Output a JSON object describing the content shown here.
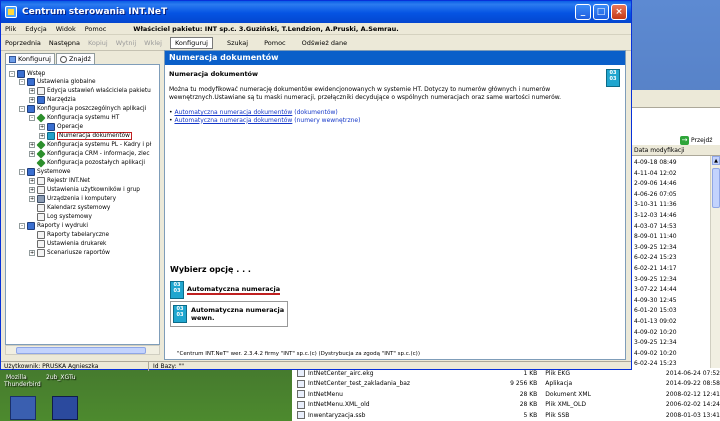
{
  "window": {
    "title": "Centrum sterowania INT.NeT",
    "buttons": {
      "minimize": "_",
      "maximize": "□",
      "close": "×"
    }
  },
  "menubar": {
    "items": [
      "Plik",
      "Edycja",
      "Widok",
      "Pomoc"
    ],
    "owner": "Właściciel pakietu: INT sp.c. 3.Guziński, T.Lendzion, A.Pruski, A.Semrau."
  },
  "toolbar": {
    "prev": "Poprzednia",
    "next": "Następna",
    "copy": "Kopiuj",
    "cut": "Wytnij",
    "paste": "Wklej",
    "config": "Konfiguruj",
    "search": "Szukaj",
    "help": "Pomoc",
    "refresh": "Odśwież dane"
  },
  "left_tabs": {
    "config": "Konfiguruj",
    "find": "Znajdź"
  },
  "tree": [
    {
      "label": "Wstęp",
      "pm": "-"
    },
    {
      "label": "Ustawienia globalne",
      "pm": "-"
    },
    {
      "label": "Edycja ustawień właściciela pakietu",
      "pm": "+"
    },
    {
      "label": "Narzędzia",
      "pm": "+"
    },
    {
      "label": "Konfiguracja poszczególnych aplikacji",
      "pm": "-"
    },
    {
      "label": "Konfiguracja systemu HT",
      "pm": "-"
    },
    {
      "label": "Operacje",
      "pm": "+"
    },
    {
      "label": "Numeracja dokumentów",
      "pm": "+"
    },
    {
      "label": "Konfiguracja systemu PL - Kadry i pł",
      "pm": "+"
    },
    {
      "label": "Konfiguracja CRM - informacje, zlec",
      "pm": "+"
    },
    {
      "label": "Konfiguracja pozostałych aplikacji",
      "pm": ""
    },
    {
      "label": "Systemowe",
      "pm": "-"
    },
    {
      "label": "Rejestr INT.Net",
      "pm": "+"
    },
    {
      "label": "Ustawienia użytkowników i grup",
      "pm": "+"
    },
    {
      "label": "Urządzenia i komputery",
      "pm": "+"
    },
    {
      "label": "Kalendarz systemowy",
      "pm": ""
    },
    {
      "label": "Log systemowy",
      "pm": ""
    },
    {
      "label": "Raporty i wydruki",
      "pm": "-"
    },
    {
      "label": "Raporty tabelaryczne",
      "pm": ""
    },
    {
      "label": "Ustawienia drukarek",
      "pm": ""
    },
    {
      "label": "Scenariusze raportów",
      "pm": "+"
    }
  ],
  "main": {
    "header": "Numeracja dokumentów",
    "subtitle": "Numeracja dokumentów",
    "description": "Można tu modyfikować numerację dokumentów ewidencjonowanych w systemie HT. Dotyczy to numerów głównych i numerów wewnętrznych.Ustawiane są tu maski numeracji, przełączniki decydujące o wspólnych numeracjach oraz same wartości numerów.",
    "link1": "Automatyczna numeracja dokumentów",
    "link1_note": "(dokumentów)",
    "link2": "Automatyczna numeracja dokumentów",
    "link2_note": "(numery wewnętrzne)",
    "choose": "Wybierz opcję . . .",
    "option1": "Automatyczna numeracja",
    "option2_line1": "Automatyczna numeracja",
    "option2_line2": "wewn.",
    "footer": "\"Centrum INT.NeT\" wer. 2.3.4.2 firmy \"INT\" sp.c.(c) (Dystrybucja za zgodą \"INT\" sp.c.(c))",
    "icon_text": "03"
  },
  "status": {
    "user": "Użytkownik: PRUSKA Agnieszka",
    "db": "Id Bazy: \"\""
  },
  "explorer": {
    "go": "Przejdź",
    "column": "Data modyfikacji",
    "dates": [
      "4-09-18 08:49",
      "4-11-04 12:02",
      "2-09-06 14:46",
      "4-06-26 07:05",
      "3-10-31 11:36",
      "3-12-03 14:46",
      "4-03-07 14:53",
      "8-09-01 11:40",
      "3-09-25 12:34",
      "6-02-24 15:23",
      "6-02-21 14:17",
      "3-09-25 12:34",
      "3-07-22 14:44",
      "4-09-30 12:45",
      "6-01-20 15:03",
      "4-01-13 09:02",
      "4-09-02 10:20",
      "3-09-25 12:34",
      "4-09-02 10:20",
      "6-02-24 15:23",
      "4-09-30 12:45"
    ]
  },
  "files": [
    {
      "name": "IntNetCenter_airc.ekg",
      "size": "1 KB",
      "type": "Plik EKG",
      "date": "2014-06-24 07:52"
    },
    {
      "name": "IntNetCenter_test_zakladania_baz",
      "size": "9 256 KB",
      "type": "Aplikacja",
      "date": "2014-09-22 08:58"
    },
    {
      "name": "IntNetMenu",
      "size": "28 KB",
      "type": "Dokument XML",
      "date": "2008-02-12 12:41"
    },
    {
      "name": "IntNetMenu.XML_old",
      "size": "28 KB",
      "type": "Plik XML_OLD",
      "date": "2006-02-02 14:24"
    },
    {
      "name": "Inwentaryzacja.ssb",
      "size": "5 KB",
      "type": "Plik SSB",
      "date": "2008-01-03 13:41"
    }
  ],
  "desktop": {
    "label1": "Mozilla",
    "label2": "Thunderbird",
    "label3": "2ub_XGTu"
  }
}
